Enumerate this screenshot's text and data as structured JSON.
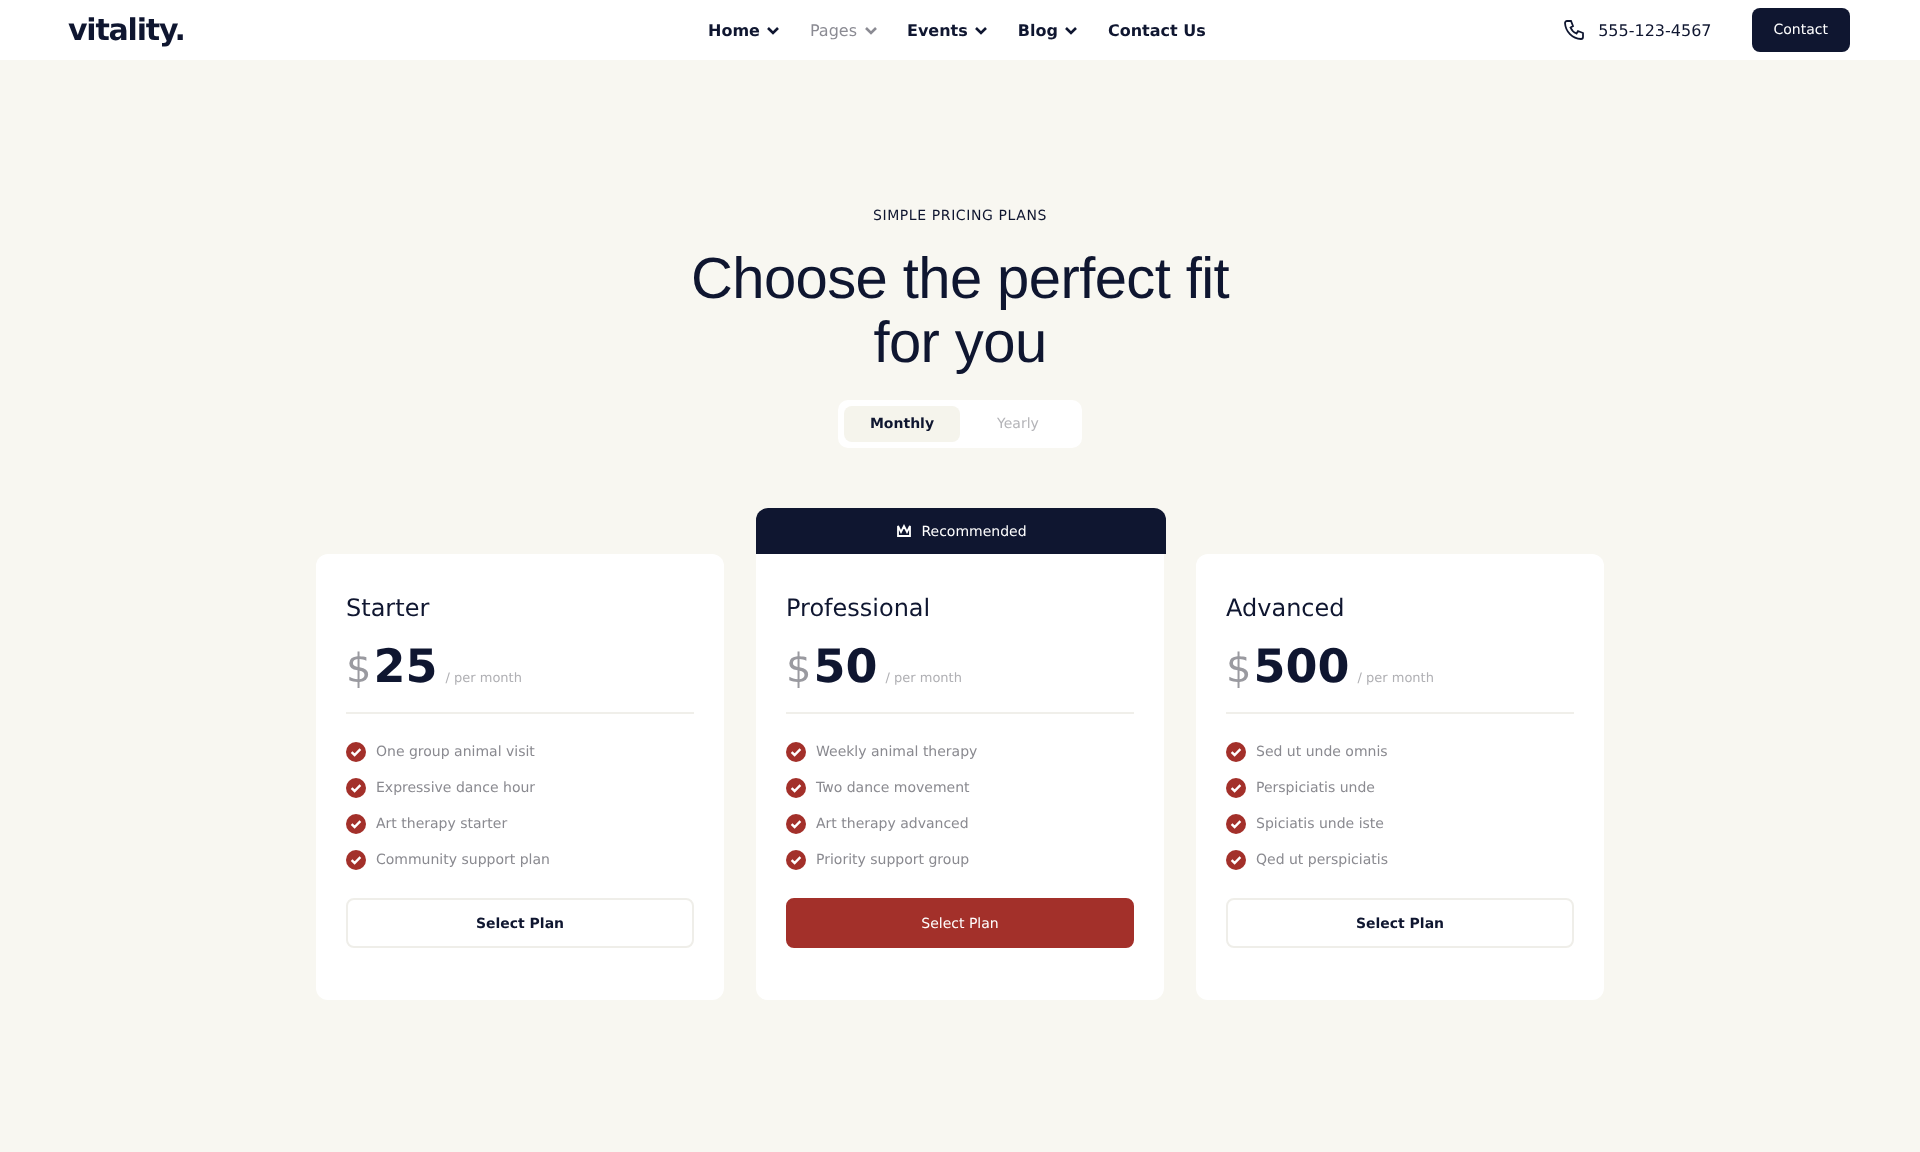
{
  "header": {
    "logo": "vitality.",
    "nav": [
      {
        "label": "Home",
        "dropdown": true,
        "selected": false
      },
      {
        "label": "Pages",
        "dropdown": true,
        "selected": true
      },
      {
        "label": "Events",
        "dropdown": true,
        "selected": false
      },
      {
        "label": "Blog",
        "dropdown": true,
        "selected": false
      },
      {
        "label": "Contact Us",
        "dropdown": false,
        "selected": false
      }
    ],
    "phone": "555-123-4567",
    "contact_button": "Contact"
  },
  "eyebrow": "SIMPLE PRICING PLANS",
  "heading": "Choose the perfect fit for you",
  "billing_toggle": [
    {
      "label": "Monthly",
      "selected": true
    },
    {
      "label": "Yearly",
      "selected": false
    }
  ],
  "plans": [
    {
      "name": "Starter",
      "currency": "$",
      "price": "25",
      "period": "/ per month",
      "featured": false,
      "features": [
        "One group animal visit",
        "Expressive dance hour",
        "Art therapy starter",
        "Community support plan"
      ],
      "button": "Select Plan"
    },
    {
      "name": "Professional",
      "currency": "$",
      "price": "50",
      "period": "/ per month",
      "featured": true,
      "badge": "Recommended",
      "features": [
        "Weekly animal therapy",
        "Two dance movement",
        "Art therapy advanced",
        "Priority support group"
      ],
      "button": "Select Plan"
    },
    {
      "name": "Advanced",
      "currency": "$",
      "price": "500",
      "period": "/ per month",
      "featured": false,
      "features": [
        "Sed ut unde omnis",
        "Perspiciatis unde",
        "Spiciatis unde iste",
        "Qed ut perspiciatis"
      ],
      "button": "Select Plan"
    }
  ]
}
